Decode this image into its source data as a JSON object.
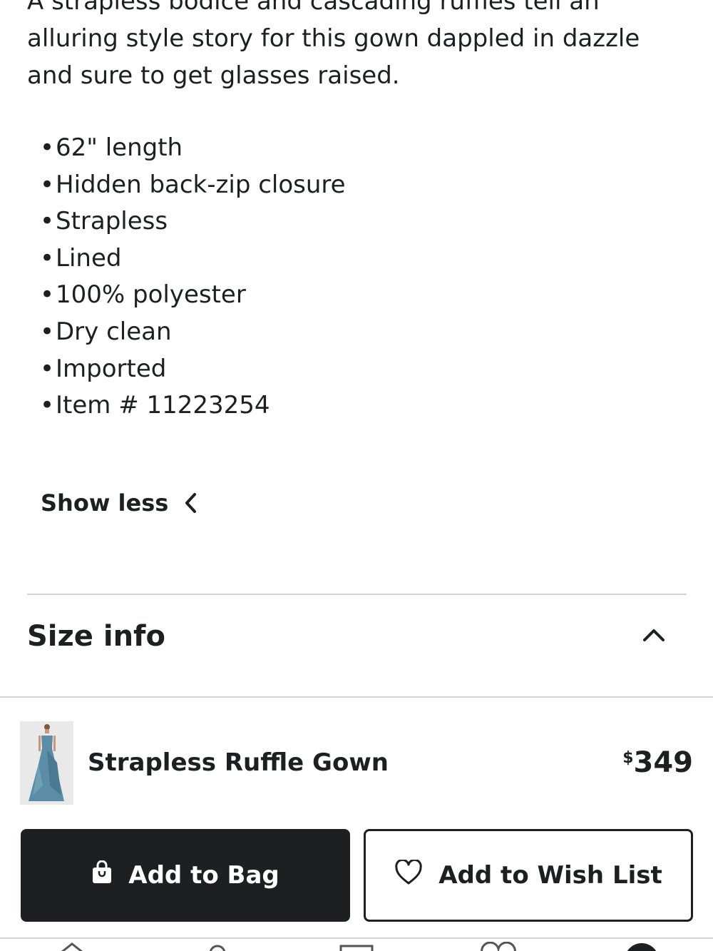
{
  "description": "A strapless bodice and cascading ruffles tell an alluring style story for this gown dappled in dazzle and sure to get glasses raised.",
  "bullets": [
    "62\" length",
    "Hidden back-zip closure",
    "Strapless",
    "Lined",
    "100% polyester",
    "Dry clean",
    "Imported",
    "Item # 11223254"
  ],
  "bullet_symbol": "•",
  "show_less_label": "Show less",
  "size_info_label": "Size info",
  "product": {
    "name": "Strapless Ruffle Gown",
    "price_currency": "$",
    "price_amount": "349"
  },
  "buttons": {
    "add_to_bag": "Add to Bag",
    "add_to_wish_list": "Add to Wish List"
  },
  "colors": {
    "text": "#1d1f21",
    "primary_button": "#1d1f21",
    "divider": "#d3d3d3",
    "gown": "#5b8ea6"
  },
  "icons": {
    "show_less": "chevron-left-icon",
    "size_info": "chevron-up-icon",
    "add_to_bag": "shopping-bag-icon",
    "wish_list": "heart-outline-icon",
    "tabs": [
      "home-icon",
      "search-icon",
      "shop-icon",
      "wishlist-icon",
      "account-icon"
    ]
  }
}
